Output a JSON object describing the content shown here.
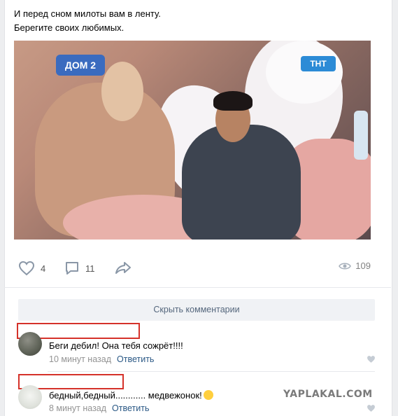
{
  "post": {
    "text_line1": "И перед сном милоты вам в ленту.",
    "text_line2": "Берегите своих любимых.",
    "photo_logo_left": "ДОМ 2",
    "photo_logo_right": "ТНТ"
  },
  "actions": {
    "likes": "4",
    "comments": "11",
    "views": "109"
  },
  "hide_comments_label": "Скрыть комментарии",
  "comments": [
    {
      "text": "Беги дебил! Она тебя сожрёт!!!!",
      "time": "10 минут назад",
      "reply": "Ответить"
    },
    {
      "text": "бедный,бедный............ медвежонок!",
      "time": "8 минут назад",
      "reply": "Ответить"
    }
  ],
  "watermark": "YAPLAKAL.COM",
  "colors": {
    "accent": "#2a5885",
    "highlight_box": "#d5322a",
    "button_bg": "#f0f2f5"
  }
}
